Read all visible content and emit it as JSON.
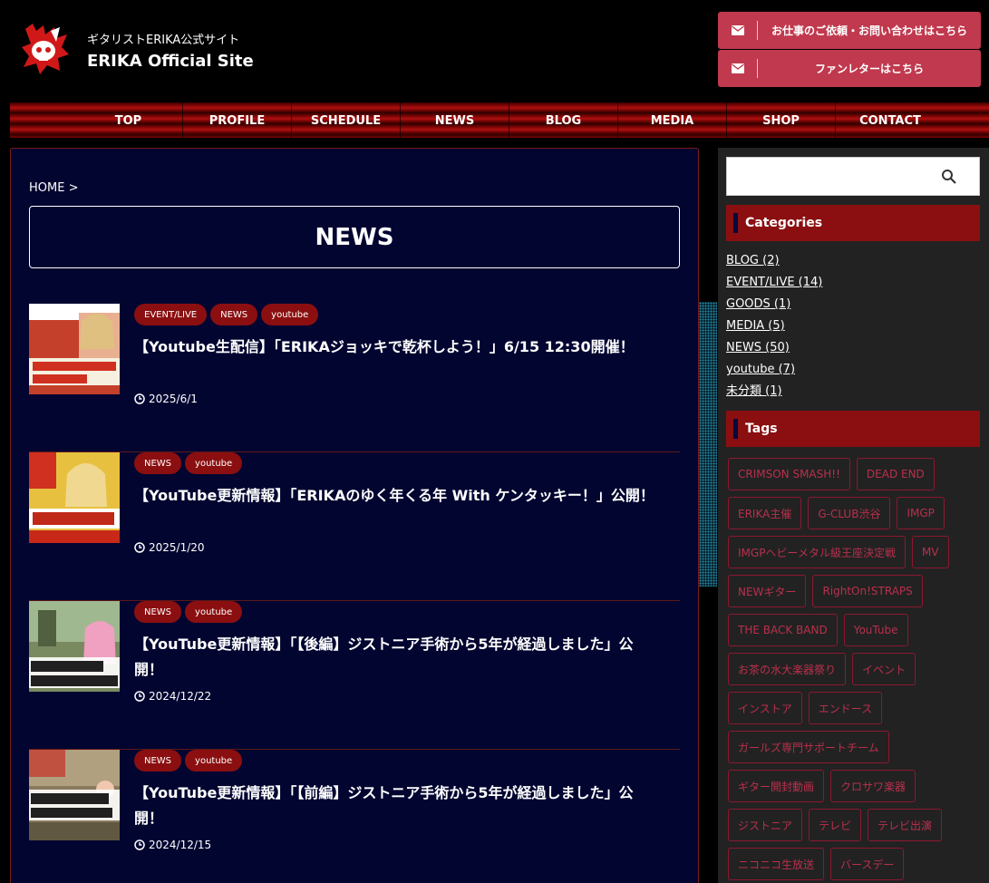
{
  "header": {
    "subtitle": "ギタリストERIKA公式サイト",
    "title": "ERIKA Official Site",
    "buttons": [
      {
        "label": "お仕事のご依頼・お問い合わせはこちら",
        "icon": "mail-icon"
      },
      {
        "label": "ファンレターはこちら",
        "icon": "mail-icon"
      }
    ]
  },
  "nav": [
    "TOP",
    "PROFILE",
    "SCHEDULE",
    "NEWS",
    "BLOG",
    "MEDIA",
    "SHOP",
    "CONTACT"
  ],
  "main": {
    "breadcrumb": "HOME >",
    "page_title": "NEWS",
    "posts": [
      {
        "cats": [
          "EVENT/LIVE",
          "NEWS",
          "youtube"
        ],
        "title": "【Youtube生配信】「ERIKAジョッキで乾杯しよう！」6/15 12:30開催！",
        "date": "2025/6/1"
      },
      {
        "cats": [
          "NEWS",
          "youtube"
        ],
        "title": "【YouTube更新情報】「ERIKAのゆく年くる年 With ケンタッキー！」公開！",
        "date": "2025/1/20"
      },
      {
        "cats": [
          "NEWS",
          "youtube"
        ],
        "title": "【YouTube更新情報】「【後編】ジストニア手術から5年が経過しました」公開！",
        "date": "2024/12/22"
      },
      {
        "cats": [
          "NEWS",
          "youtube"
        ],
        "title": "【YouTube更新情報】「【前編】ジストニア手術から5年が経過しました」公開！",
        "date": "2024/12/15"
      }
    ]
  },
  "sidebar": {
    "categories_title": "Categories",
    "categories": [
      "BLOG (2)",
      "EVENT/LIVE (14)",
      "GOODS (1)",
      "MEDIA (5)",
      "NEWS (50)",
      "youtube (7)",
      "未分類 (1)"
    ],
    "tags_title": "Tags",
    "tags": [
      "CRIMSON SMASH!!",
      "DEAD END",
      "ERIKA主催",
      "G-CLUB渋谷",
      "IMGP",
      "IMGPヘビーメタル級王座決定戦",
      "MV",
      "NEWギター",
      "RightOn!STRAPS",
      "THE BACK BAND",
      "YouTube",
      "お茶の水大楽器祭り",
      "イベント",
      "インストア",
      "エンドース",
      "ガールズ専門サポートチーム",
      "ギター開封動画",
      "クロサワ楽器",
      "ジストニア",
      "テレビ",
      "テレビ出演",
      "ニコニコ生放送",
      "バースデー"
    ]
  },
  "colors": {
    "accent_red": "#8b0f10",
    "button_pink": "#c0394e",
    "main_bg": "#020530",
    "tag_text": "#b9304c"
  }
}
